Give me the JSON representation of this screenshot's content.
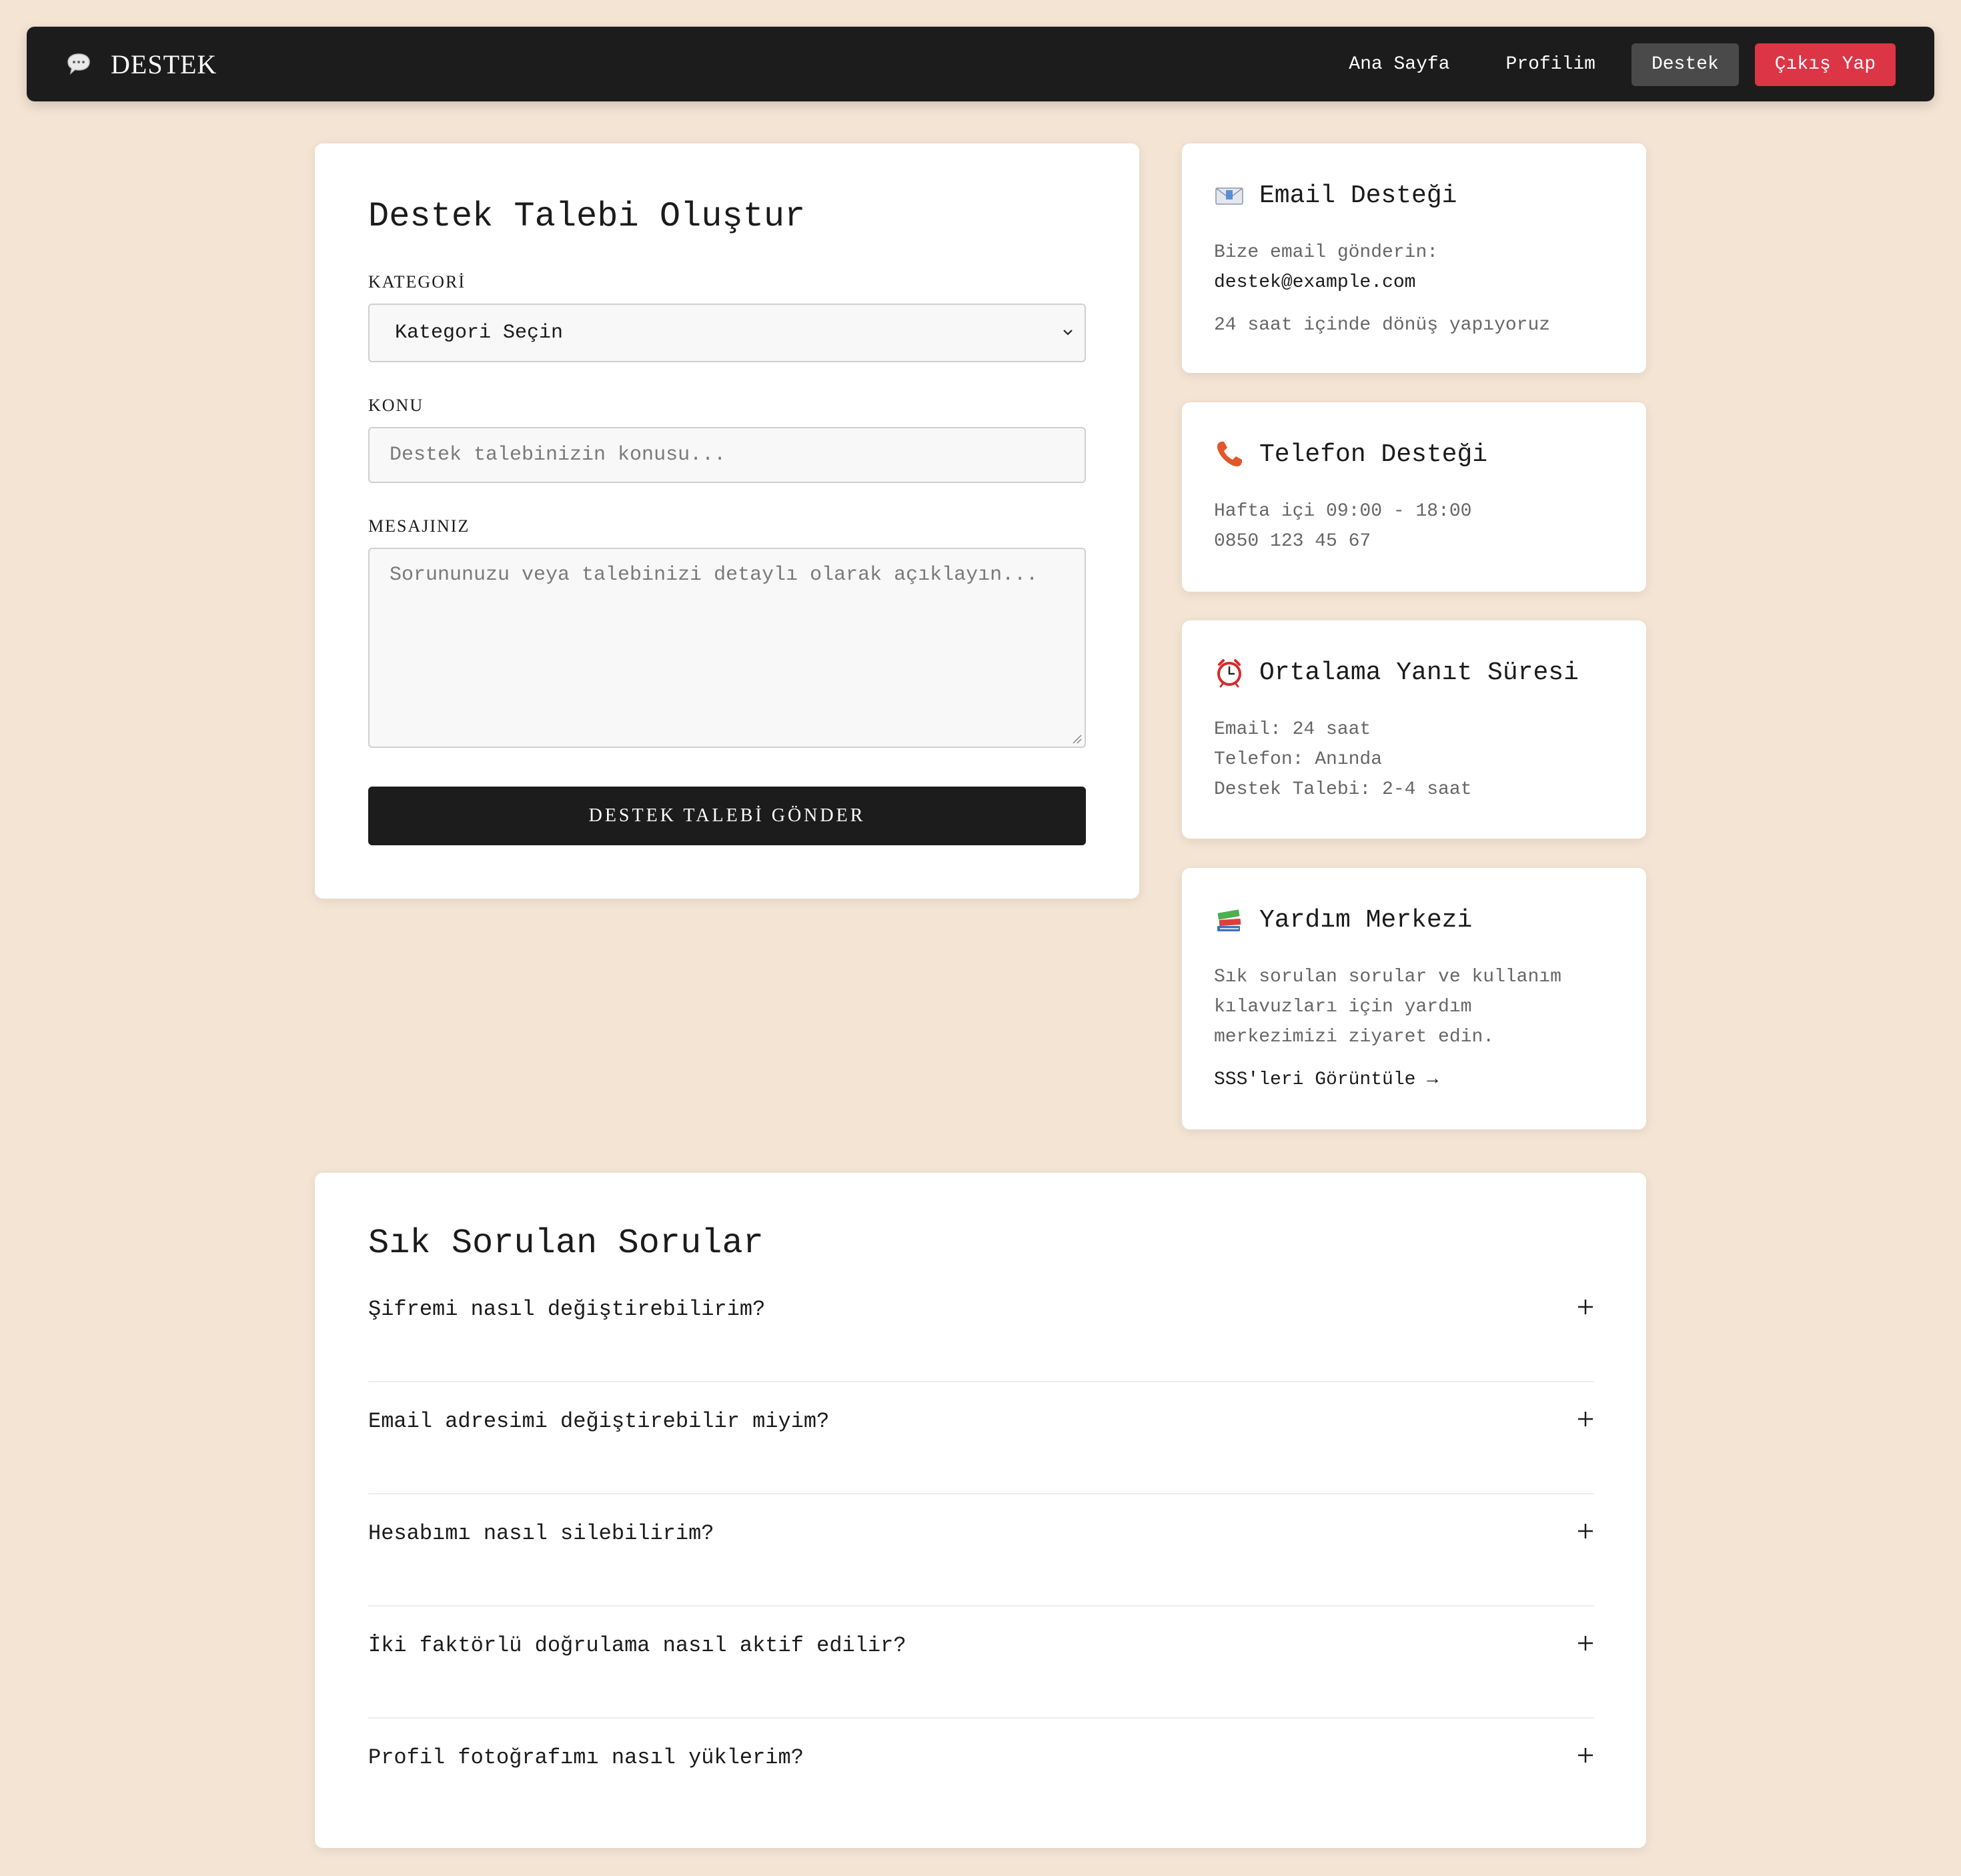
{
  "nav": {
    "brand": "DESTEK",
    "brand_icon": "speech-bubble-icon",
    "links": [
      {
        "label": "Ana Sayfa"
      },
      {
        "label": "Profilim"
      },
      {
        "label": "Destek"
      },
      {
        "label": "Çıkış Yap"
      }
    ],
    "colors": {
      "bar": "#1c1c1c",
      "active": "#4a4a4a",
      "logout": "#dc3545"
    }
  },
  "form": {
    "title": "Destek Talebi Oluştur",
    "category_label": "KATEGORİ",
    "category_value": "Kategori Seçin",
    "subject_label": "KONU",
    "subject_placeholder": "Destek talebinizin konusu...",
    "message_label": "MESAJINIZ",
    "message_placeholder": "Sorununuzu veya talebinizi detaylı olarak açıklayın...",
    "submit_label": "DESTEK TALEBİ GÖNDER"
  },
  "info": {
    "email": {
      "icon": "envelope-icon",
      "title": "Email Desteği",
      "line1": "Bize email gönderin:",
      "address": "destek@example.com",
      "note": "24 saat içinde dönüş yapıyoruz"
    },
    "phone": {
      "icon": "telephone-icon",
      "title": "Telefon Desteği",
      "hours": "Hafta içi 09:00 - 18:00",
      "number": "0850 123 45 67"
    },
    "response": {
      "icon": "alarm-clock-icon",
      "title": "Ortalama Yanıt Süresi",
      "email": "Email: 24 saat",
      "phone": "Telefon: Anında",
      "ticket": "Destek Talebi: 2-4 saat"
    },
    "help": {
      "icon": "books-icon",
      "title": "Yardım Merkezi",
      "desc_lines": [
        "Sık sorulan sorular ve kullanım",
        "kılavuzları için yardım",
        "merkezimizi ziyaret edin."
      ],
      "link": "SSS'leri Görüntüle →"
    }
  },
  "faq": {
    "title": "Sık Sorulan Sorular",
    "items": [
      {
        "q": "Şifremi nasıl değiştirebilirim?"
      },
      {
        "q": "Email adresimi değiştirebilir miyim?"
      },
      {
        "q": "Hesabımı nasıl silebilirim?"
      },
      {
        "q": "İki faktörlü doğrulama nasıl aktif edilir?"
      },
      {
        "q": "Profil fotoğrafımı nasıl yüklerim?"
      }
    ]
  }
}
